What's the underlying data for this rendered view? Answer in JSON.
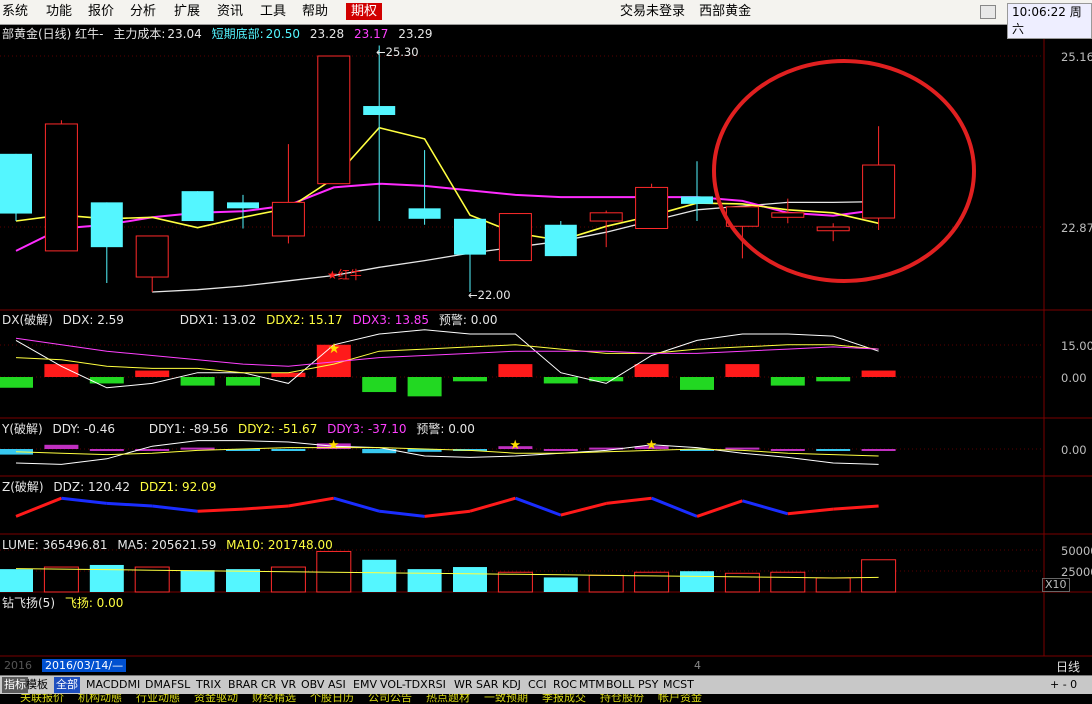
{
  "menu": {
    "items": [
      "系统",
      "功能",
      "报价",
      "分析",
      "扩展",
      "资讯",
      "工具",
      "帮助"
    ],
    "active_item": "期权",
    "login_status": "交易未登录",
    "instrument": "西部黄金",
    "clock": "10:06:22 周六"
  },
  "main_pane": {
    "title": "部黄金(日线) 红牛-",
    "cost_label": "主力成本:",
    "cost_value": "23.04",
    "bottom_label": "短期底部:",
    "values": [
      "20.50",
      "23.28",
      "23.17",
      "23.29"
    ],
    "axis": [
      "25.16",
      "22.87"
    ],
    "high_note": "25.30",
    "low_note": "22.00",
    "signal_label": "★红牛",
    "colors": {
      "up": "#ff2a2a",
      "down": "#54f6ff",
      "ma_yellow": "#ffff40",
      "ma_magenta": "#ff2cff",
      "ma_white": "#e6e6e6"
    }
  },
  "ddx_pane": {
    "name": "DX(破解)",
    "ddx": "DDX: 2.59",
    "ddx1": "DDX1: 13.02",
    "ddx2": "DDX2: 15.17",
    "ddx3": "DDX3: 13.85",
    "warn": "预警: 0.00",
    "axis": [
      "15.00",
      "0.00"
    ]
  },
  "ddy_pane": {
    "name": "Y(破解)",
    "ddy": "DDY: -0.46",
    "ddy1": "DDY1: -89.56",
    "ddy2": "DDY2: -51.67",
    "ddy3": "DDY3: -37.10",
    "warn": "预警: 0.00",
    "axis": [
      "0.00"
    ]
  },
  "ddz_pane": {
    "name": "Z(破解)",
    "ddz": "DDZ: 120.42",
    "ddz1": "DDZ1: 92.09"
  },
  "volume_pane": {
    "name": "LUME: 365496.81",
    "ma5": "MA5: 205621.59",
    "ma10": "MA10: 201748.00",
    "axis": [
      "50000",
      "25000"
    ],
    "multiplier": "X10"
  },
  "fly_pane": {
    "name": "钻飞扬(5)",
    "value": "飞扬: 0.00"
  },
  "date_bar": {
    "left": "2016",
    "current": "2016/03/14/—",
    "mid": "4",
    "period": "日线"
  },
  "tabs": {
    "side_labels": [
      "指标",
      "模板"
    ],
    "items": [
      "全部",
      "MACD",
      "DMI",
      "DMA",
      "FSL",
      "TRIX",
      "BRAR",
      "CR",
      "VR",
      "OBV",
      "ASI",
      "EMV",
      "VOL-TDX",
      "RSI",
      "WR",
      "SAR",
      "KDJ",
      "CCI",
      "ROC",
      "MTM",
      "BOLL",
      "PSY",
      "MCST"
    ],
    "right": "+  -  0"
  },
  "bottom_bar": {
    "items": [
      "关联报价",
      "机构动態",
      "行业动態",
      "资金驱动",
      "财经精选",
      "个股日历",
      "公司公告",
      "热点题材",
      "一致预期",
      "季报成交",
      "持仓股份",
      "帐户资金"
    ]
  },
  "candles": [
    {
      "o": 23.85,
      "c": 23.05,
      "h": 23.85,
      "l": 22.95
    },
    {
      "o": 22.55,
      "c": 24.25,
      "h": 24.3,
      "l": 22.55
    },
    {
      "o": 23.2,
      "c": 22.6,
      "h": 23.2,
      "l": 22.12
    },
    {
      "o": 22.2,
      "c": 22.75,
      "h": 22.75,
      "l": 22.0
    },
    {
      "o": 23.35,
      "c": 22.95,
      "h": 23.35,
      "l": 22.95
    },
    {
      "o": 23.2,
      "c": 23.12,
      "h": 23.3,
      "l": 22.85
    },
    {
      "o": 22.75,
      "c": 23.2,
      "h": 23.98,
      "l": 22.65
    },
    {
      "o": 23.45,
      "c": 25.16,
      "h": 25.16,
      "l": 23.45
    },
    {
      "o": 24.49,
      "c": 24.37,
      "h": 25.3,
      "l": 22.95
    },
    {
      "o": 23.12,
      "c": 22.98,
      "h": 23.9,
      "l": 22.9
    },
    {
      "o": 22.98,
      "c": 22.5,
      "h": 22.98,
      "l": 22.0
    },
    {
      "o": 22.42,
      "c": 23.05,
      "h": 23.05,
      "l": 22.42
    },
    {
      "o": 22.9,
      "c": 22.48,
      "h": 22.95,
      "l": 22.48
    },
    {
      "o": 22.95,
      "c": 23.06,
      "h": 23.09,
      "l": 22.6
    },
    {
      "o": 22.85,
      "c": 23.4,
      "h": 23.45,
      "l": 22.85
    },
    {
      "o": 23.28,
      "c": 23.18,
      "h": 23.75,
      "l": 22.95
    },
    {
      "o": 22.88,
      "c": 23.14,
      "h": 23.14,
      "l": 22.45
    },
    {
      "o": 23.0,
      "c": 23.06,
      "h": 23.25,
      "l": 22.92
    },
    {
      "o": 22.82,
      "c": 22.87,
      "h": 22.92,
      "l": 22.68
    },
    {
      "o": 22.99,
      "c": 23.7,
      "h": 24.22,
      "l": 22.83
    }
  ],
  "ma_yellow": [
    22.95,
    23.03,
    22.98,
    23.0,
    22.86,
    23.0,
    23.12,
    23.52,
    24.2,
    24.05,
    23.03,
    22.79,
    22.69,
    22.88,
    23.02,
    23.19,
    23.18,
    23.1,
    23.06,
    22.92
  ],
  "ma_magenta": [
    22.55,
    22.85,
    22.9,
    23.0,
    23.06,
    23.08,
    23.16,
    23.4,
    23.45,
    23.42,
    23.36,
    23.3,
    23.27,
    23.27,
    23.27,
    23.27,
    23.22,
    23.06,
    23.02,
    23.1
  ],
  "ma_white": [
    null,
    null,
    null,
    22.0,
    22.03,
    22.08,
    22.15,
    22.22,
    22.33,
    22.42,
    22.52,
    22.6,
    22.68,
    22.8,
    22.95,
    23.1,
    23.15,
    23.2,
    23.2,
    23.21
  ],
  "ddx_bars": [
    -5,
    6,
    -3,
    3,
    -4,
    -4,
    2,
    15,
    -7,
    -9,
    -2,
    6,
    -3,
    -2,
    6,
    -6,
    6,
    -4,
    -2,
    3
  ],
  "ddx_line_white": [
    17,
    5,
    -5,
    -3,
    2,
    2,
    -3,
    15,
    20,
    22,
    20,
    20,
    2,
    -3,
    10,
    17,
    20,
    20,
    19,
    12
  ],
  "ddx_line_yellow": [
    9,
    8,
    5,
    4,
    4,
    2,
    2,
    6,
    12,
    13,
    14,
    15,
    13,
    11,
    11,
    13,
    14,
    15,
    15,
    13
  ],
  "ddx_line_mag": [
    18,
    15,
    12,
    10,
    8,
    6,
    5,
    7,
    9,
    10,
    11,
    12,
    12,
    12,
    11,
    11,
    12,
    13,
    14,
    13
  ],
  "ddy_bars": [
    -0.4,
    0.3,
    0.0,
    0.0,
    0.1,
    -0.1,
    -0.1,
    0.4,
    -0.3,
    -0.2,
    -0.1,
    0.2,
    0.0,
    0.1,
    0.2,
    -0.1,
    0.1,
    0.0,
    -0.1,
    0.0
  ],
  "ddy_line_white": [
    -1.0,
    -1.1,
    -0.7,
    0.2,
    0.6,
    0.6,
    0.5,
    0.2,
    0.1,
    -0.5,
    -0.6,
    -0.5,
    -0.3,
    -0.1,
    0.3,
    0.1,
    -0.3,
    -0.6,
    -1.0,
    -1.1
  ],
  "ddy_line_yellow": [
    -0.2,
    -0.3,
    -0.4,
    -0.3,
    -0.1,
    0.0,
    0.1,
    0.1,
    0.1,
    0.0,
    -0.1,
    -0.3,
    -0.3,
    -0.2,
    -0.1,
    0.0,
    -0.1,
    -0.3,
    -0.4,
    -0.5
  ],
  "ddz_values": [
    60,
    130,
    110,
    100,
    80,
    88,
    100,
    130,
    80,
    60,
    80,
    130,
    65,
    110,
    130,
    60,
    120,
    70,
    88,
    100
  ],
  "vol_bars": [
    44,
    48,
    52,
    48,
    42,
    44,
    48,
    78,
    62,
    44,
    48,
    38,
    28,
    32,
    38,
    40,
    36,
    38,
    27,
    62
  ],
  "vol_ma": [
    45,
    44,
    43,
    42,
    41,
    40,
    39,
    38,
    37,
    36,
    35,
    34,
    33,
    32,
    31,
    30,
    29,
    28,
    27,
    28
  ]
}
